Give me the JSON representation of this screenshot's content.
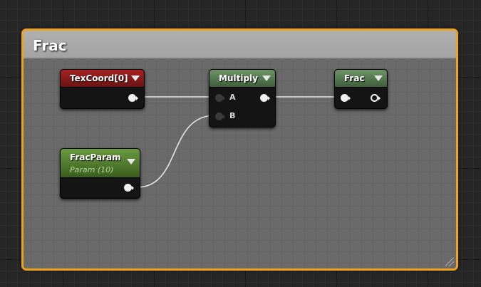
{
  "comment": {
    "title": "Frac"
  },
  "nodes": {
    "texcoord": {
      "title": "TexCoord[0]"
    },
    "multiply": {
      "title": "Multiply",
      "pin_a": "A",
      "pin_b": "B"
    },
    "frac": {
      "title": "Frac"
    },
    "fracparam": {
      "title": "FracParam",
      "subtitle": "Param (10)"
    }
  },
  "colors": {
    "comment_border": "#f0a21e",
    "texcoord_header": "#8a1a1a",
    "math_header": "#4f7a4a",
    "param_header": "#4e7a2a",
    "wire": "#e6e6e6"
  }
}
